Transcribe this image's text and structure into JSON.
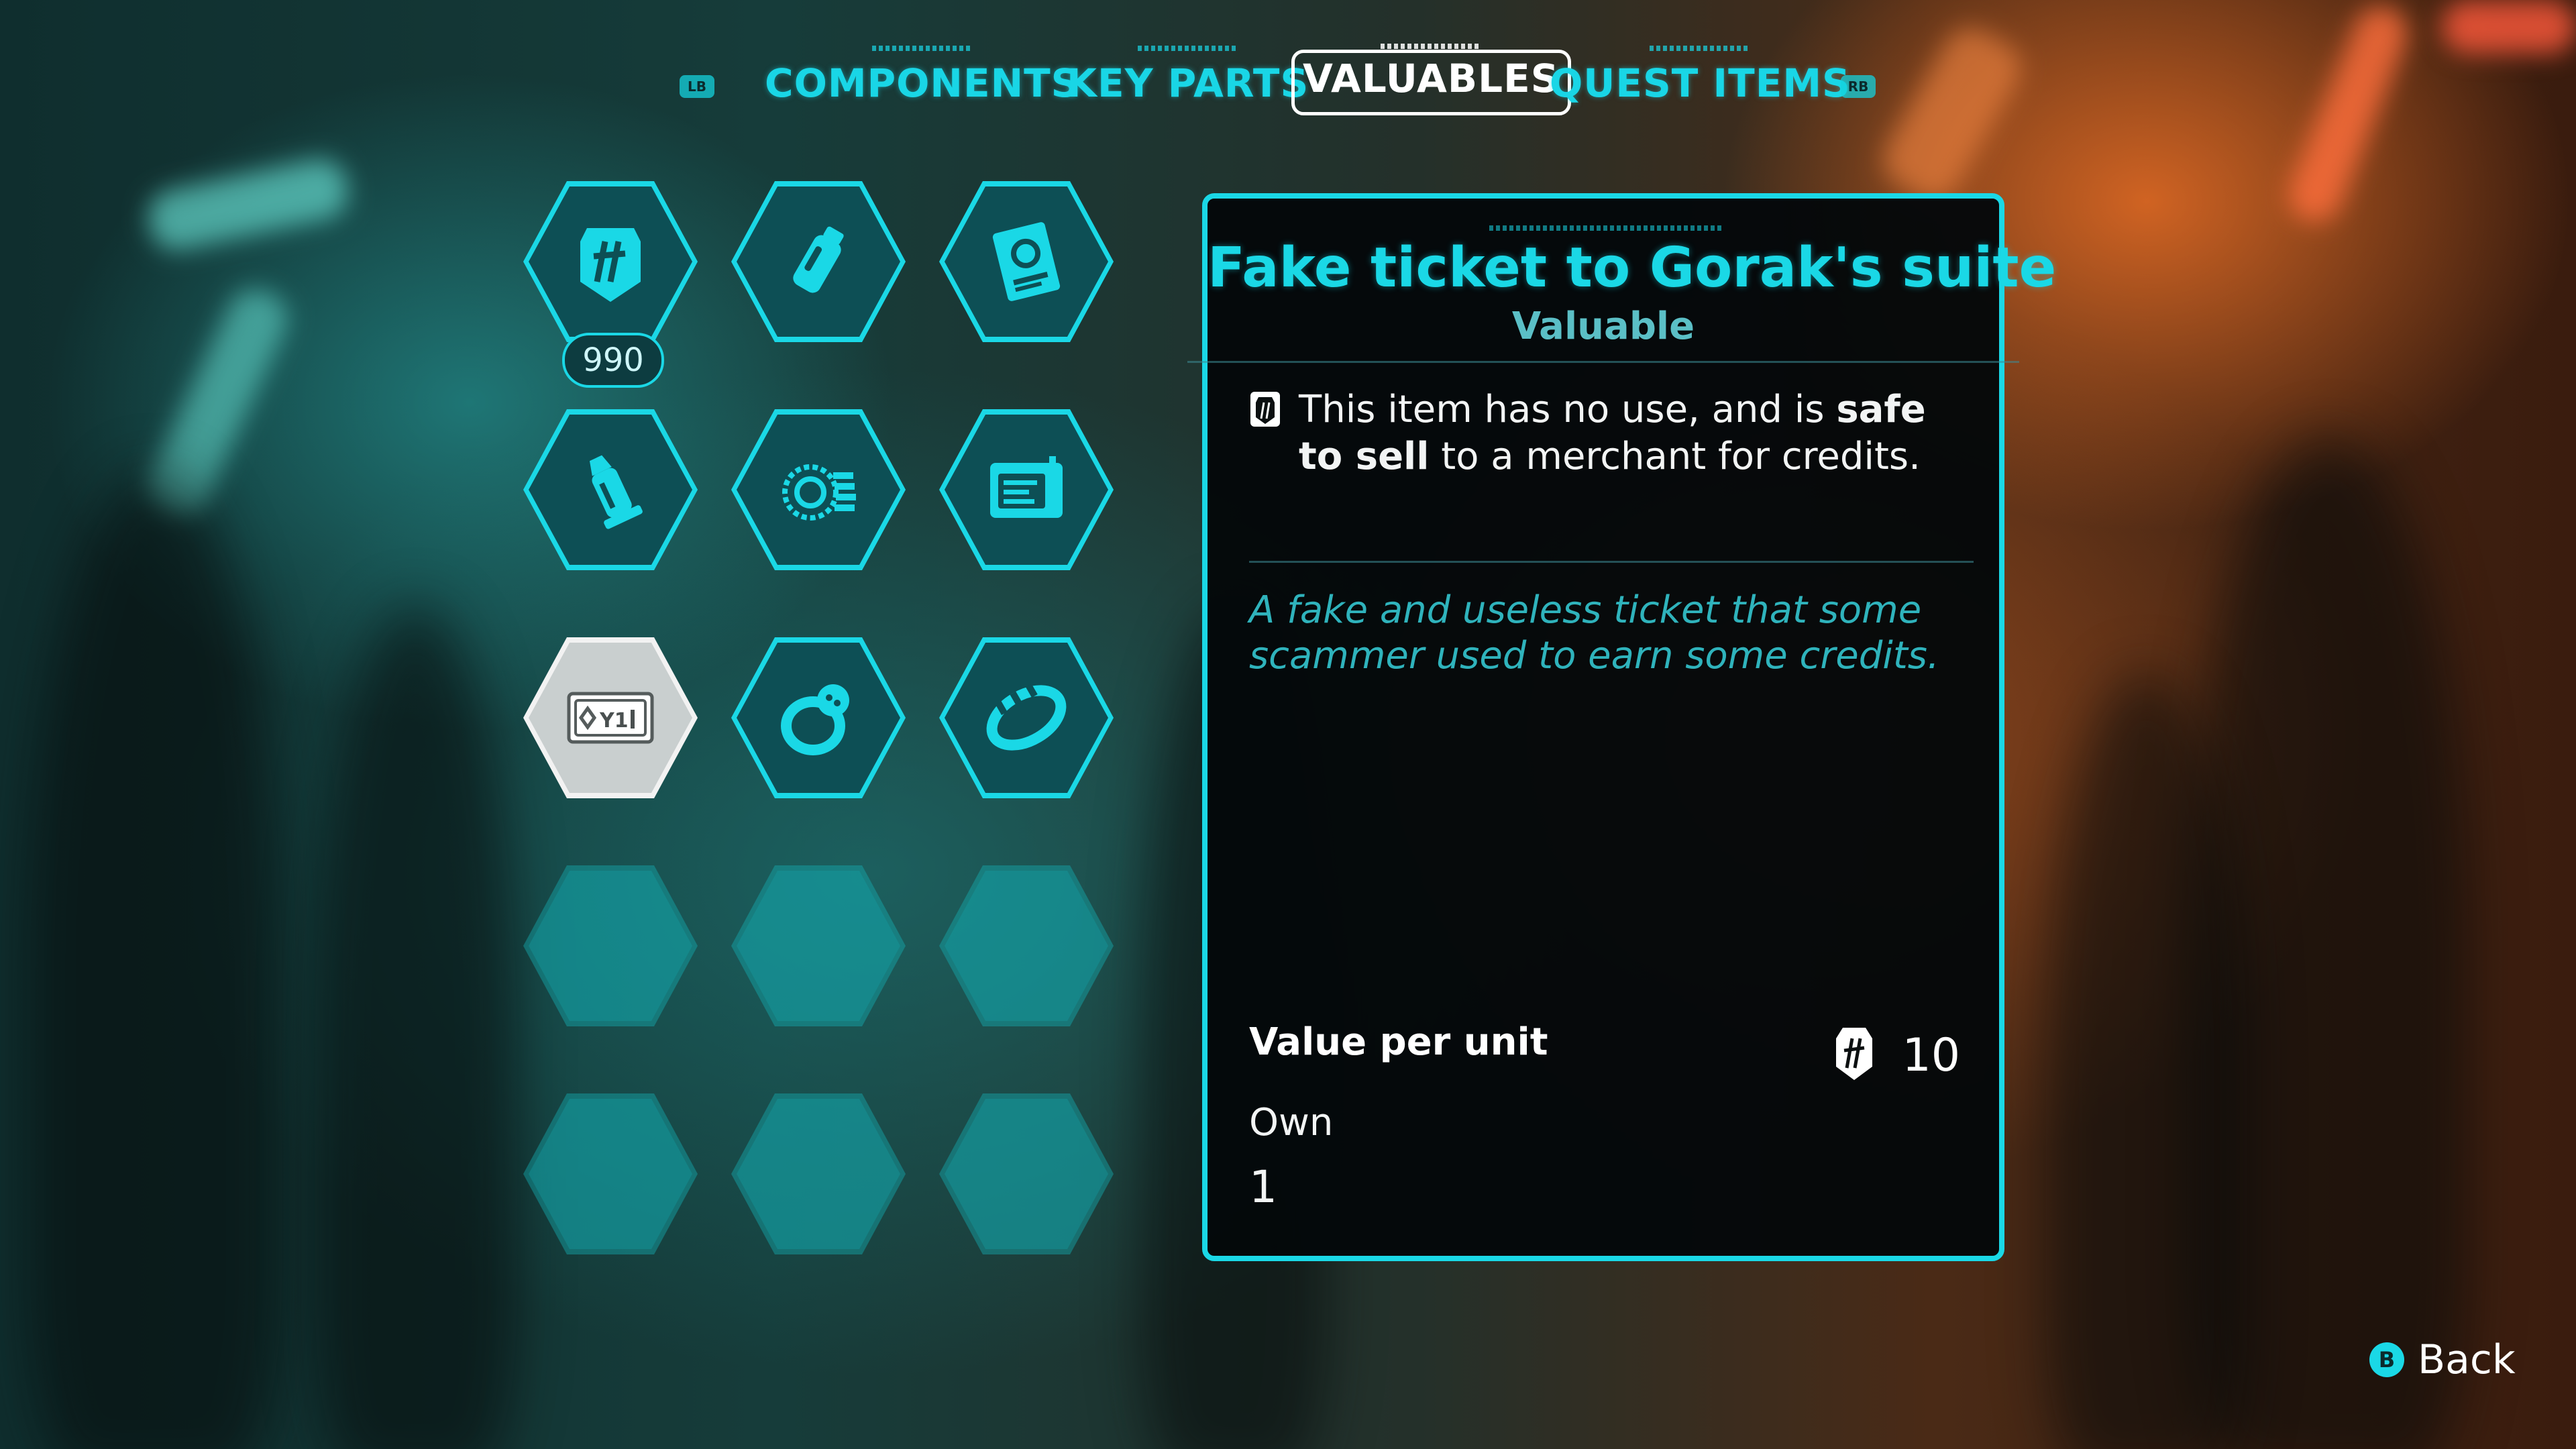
{
  "tabs": {
    "left_bumper": "LB",
    "right_bumper": "RB",
    "items": [
      {
        "label": "COMPONENTS",
        "active": false
      },
      {
        "label": "KEY PARTS",
        "active": false
      },
      {
        "label": "VALUABLES",
        "active": true
      },
      {
        "label": "QUEST ITEMS",
        "active": false
      }
    ]
  },
  "inventory": {
    "slots": [
      {
        "icon": "credit-chip-icon",
        "count": "990",
        "selected": false
      },
      {
        "icon": "canister-icon",
        "selected": false
      },
      {
        "icon": "data-book-icon",
        "selected": false
      },
      {
        "icon": "spray-canister-icon",
        "selected": false
      },
      {
        "icon": "sabacc-chips-icon",
        "selected": false
      },
      {
        "icon": "datapad-device-icon",
        "selected": false
      },
      {
        "icon": "ticket-icon",
        "selected": true
      },
      {
        "icon": "gem-ring-icon",
        "selected": false
      },
      {
        "icon": "bracelet-icon",
        "selected": false
      },
      {
        "icon": "empty-slot",
        "selected": false
      },
      {
        "icon": "empty-slot",
        "selected": false
      },
      {
        "icon": "empty-slot",
        "selected": false
      },
      {
        "icon": "empty-slot",
        "selected": false
      },
      {
        "icon": "empty-slot",
        "selected": false
      },
      {
        "icon": "empty-slot",
        "selected": false
      }
    ]
  },
  "detail": {
    "title": "Fake ticket to Gorak's suite",
    "category": "Valuable",
    "use_text_1": "This item has no use, and is ",
    "use_text_bold_1": "safe to sell",
    "use_text_2": " to a merchant for credits.",
    "flavor": "A fake and useless ticket that some scammer used to earn some credits.",
    "value_label": "Value per unit",
    "value_amount": "10",
    "own_label": "Own",
    "own_value": "1"
  },
  "footer": {
    "back_button_glyph": "B",
    "back_label": "Back"
  },
  "colors": {
    "accent": "#1ad8e6",
    "selected": "#f2f2f2",
    "panel_bg": "#04080a"
  }
}
